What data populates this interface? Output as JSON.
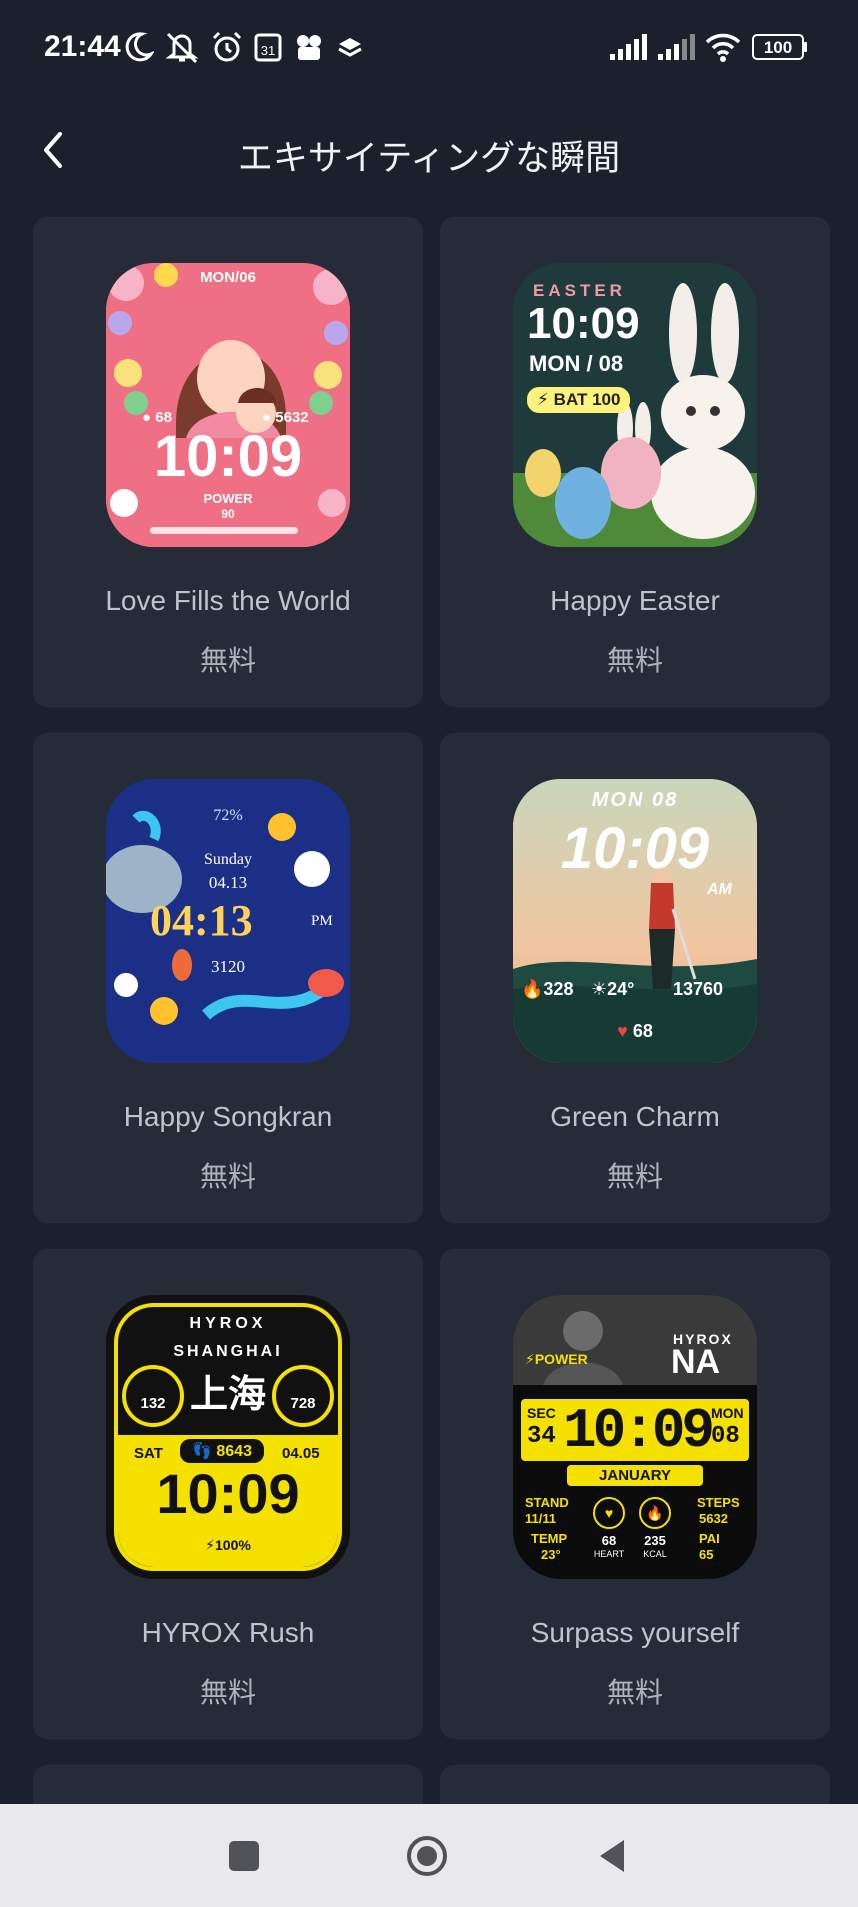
{
  "status": {
    "time": "21:44",
    "battery": "100"
  },
  "header": {
    "title": "エキサイティングな瞬間"
  },
  "cards": [
    {
      "name": "Love Fills the World",
      "price": "無料",
      "face": {
        "date": "MON/06",
        "heart": "68",
        "steps": "5632",
        "time": "10:09",
        "power_label": "POWER",
        "power_value": "90"
      }
    },
    {
      "name": "Happy Easter",
      "price": "無料",
      "face": {
        "label": "EASTER",
        "time": "10:09",
        "date": "MON / 08",
        "battery": "BAT 100"
      }
    },
    {
      "name": "Happy Songkran",
      "price": "無料",
      "face": {
        "battery": "72%",
        "day": "Sunday",
        "date": "04.13",
        "time": "04:13",
        "ampm": "PM",
        "steps": "3120"
      }
    },
    {
      "name": "Green Charm",
      "price": "無料",
      "face": {
        "date": "MON 08",
        "time": "10:09",
        "ampm": "AM",
        "kcal": "328",
        "temp": "24°",
        "steps": "13760",
        "heart": "68"
      }
    },
    {
      "name": "HYROX Rush",
      "price": "無料",
      "face": {
        "brand": "HYROX",
        "city": "SHANGHAI",
        "city_cn": "上海",
        "left_val": "132",
        "right_val": "728",
        "day": "SAT",
        "steps": "8643",
        "date": "04.05",
        "time": "10:09",
        "battery": "100%"
      }
    },
    {
      "name": "Surpass yourself",
      "price": "無料",
      "face": {
        "power": "POWER",
        "brand": "HYROX",
        "brand2": "NA",
        "sec_label": "SEC",
        "sec": "34",
        "time": "10:09",
        "day": "MON",
        "date": "08",
        "month": "JANUARY",
        "stand_label": "STAND",
        "stand": "11/11",
        "temp_label": "TEMP",
        "temp": "23°",
        "heart": "68",
        "heart_label": "HEART",
        "kcal": "235",
        "kcal_label": "KCAL",
        "steps_label": "STEPS",
        "steps": "5632",
        "pai_label": "PAI",
        "pai": "65"
      }
    }
  ],
  "colors": {
    "background": "#1c202c",
    "card": "#262b38",
    "navbar": "#e9e9ec"
  }
}
